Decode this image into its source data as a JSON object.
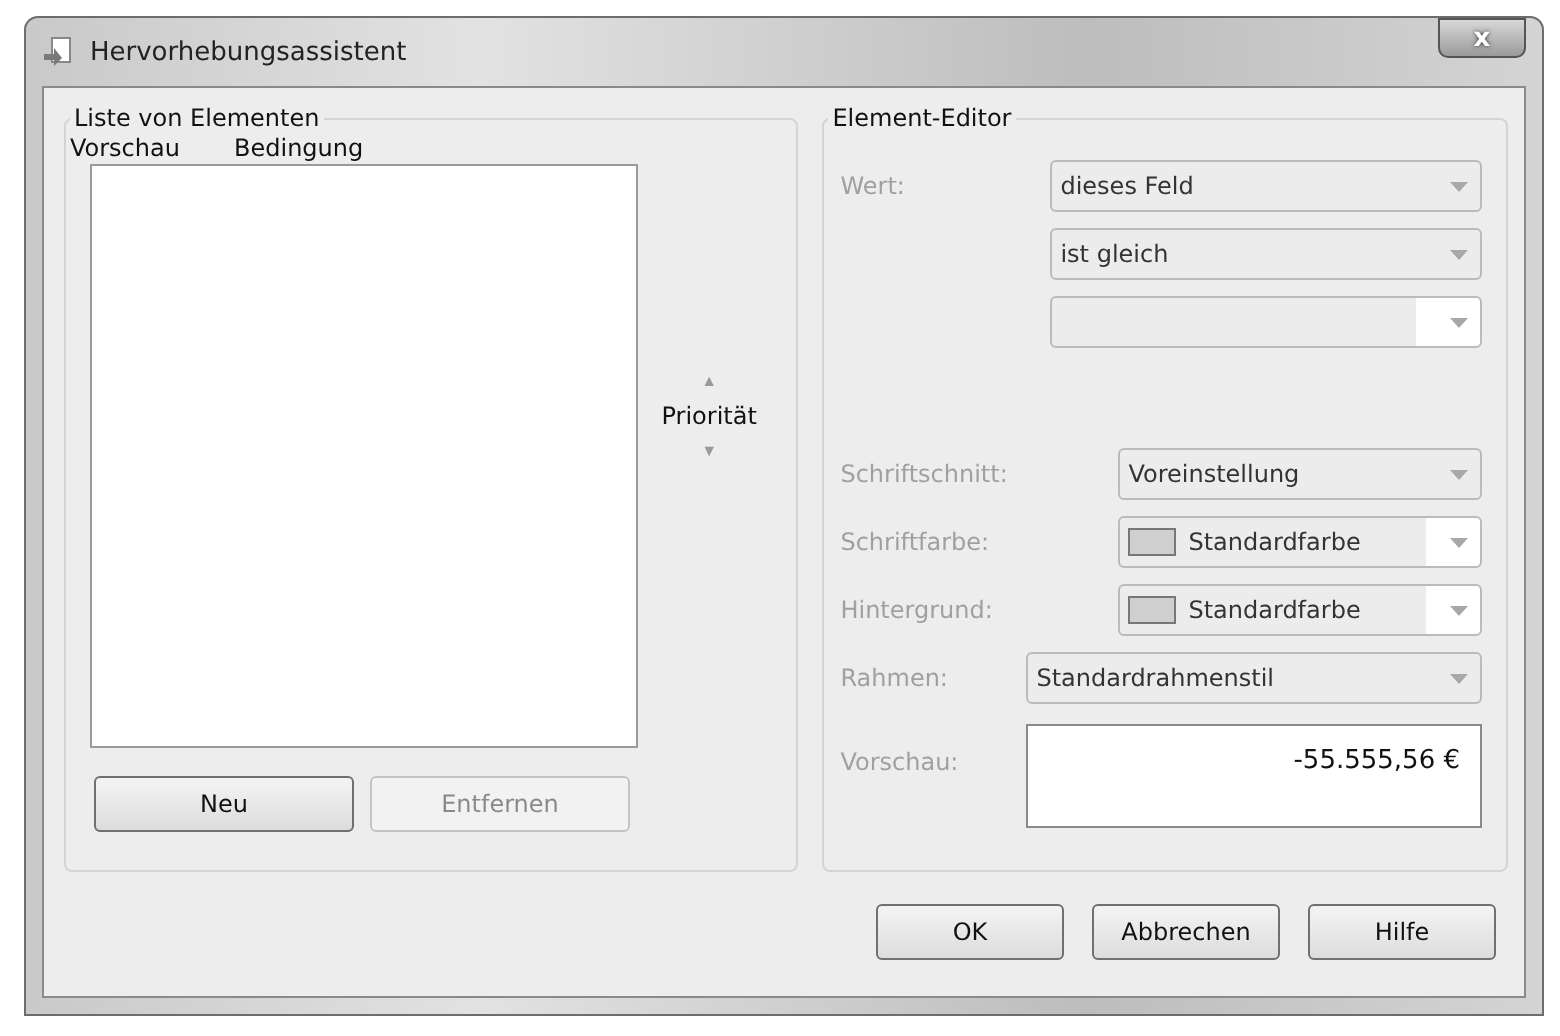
{
  "window": {
    "title": "Hervorhebungsassistent",
    "close_label": "x"
  },
  "element_list": {
    "title": "Liste von Elementen",
    "columns": [
      "Vorschau",
      "Bedingung"
    ],
    "priority": {
      "label": "Priorität",
      "up": "▲",
      "down": "▼",
      "disabled": true
    },
    "buttons": [
      {
        "label": "Neu",
        "disabled": false
      },
      {
        "label": "Entfernen",
        "disabled": true
      }
    ]
  },
  "element_editor": {
    "title": "Element-Editor",
    "rows": [
      {
        "label": "Wert:",
        "disabled": true,
        "kind": "combo",
        "value": "dieses Feld",
        "editable": false
      },
      {
        "kind": "combo",
        "value": "ist gleich",
        "editable": false
      },
      {
        "kind": "combo",
        "editable": true
      },
      {
        "label": "Schriftschnitt:",
        "disabled": true,
        "kind": "combo",
        "value": "Voreinstellung",
        "editable": false
      },
      {
        "label": "Schriftfarbe:",
        "disabled": true,
        "kind": "color-combo",
        "value": "Standardfarbe",
        "editable": true
      },
      {
        "label": "Hintergrund:",
        "disabled": true,
        "kind": "color-combo",
        "value": "Standardfarbe",
        "editable": true
      },
      {
        "label": "Rahmen:",
        "disabled": true,
        "kind": "combo",
        "value": "Standardrahmenstil",
        "editable": false
      },
      {
        "label": "Vorschau:",
        "disabled": true,
        "kind": "preview",
        "value": "-55.555,56 €"
      }
    ]
  },
  "buttons": [
    "OK",
    "Abbrechen",
    "Hilfe"
  ]
}
